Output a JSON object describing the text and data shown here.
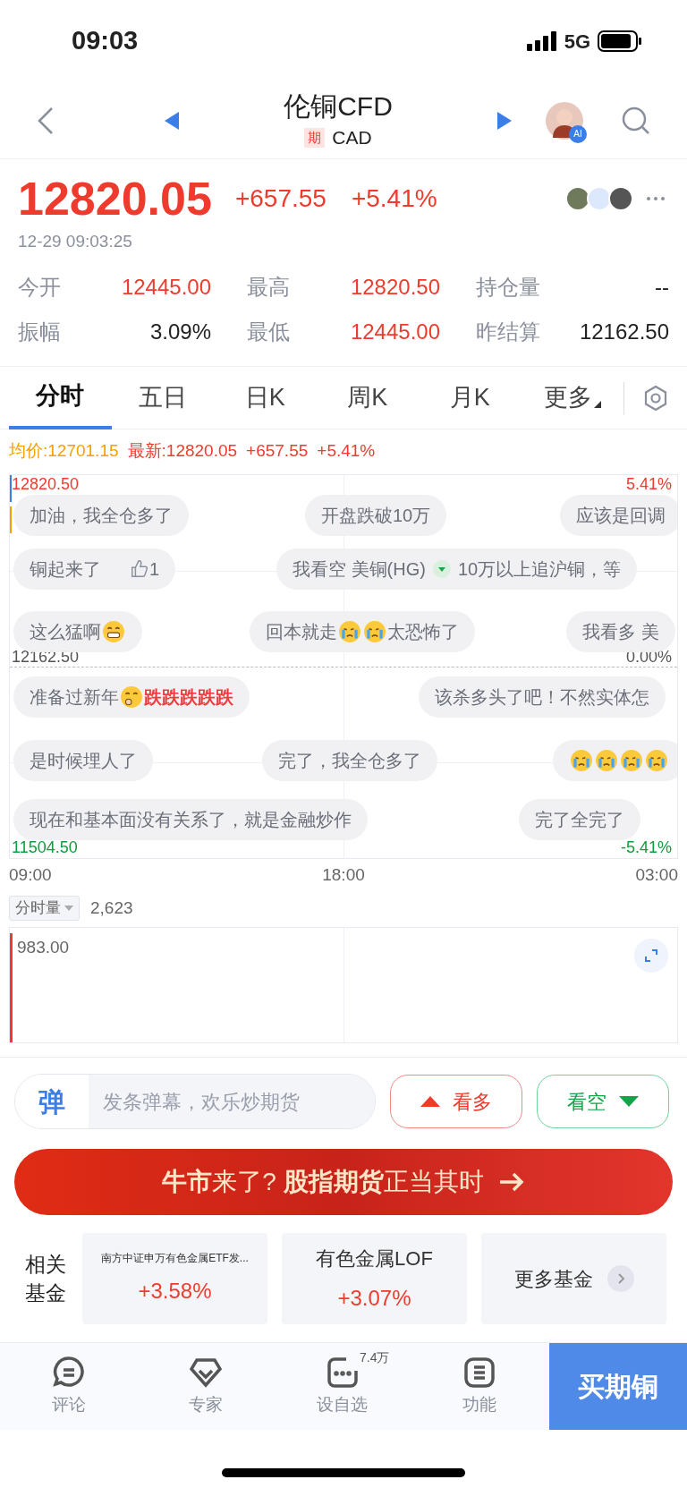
{
  "status_bar": {
    "time": "09:03",
    "network": "5G"
  },
  "header": {
    "title": "伦铜CFD",
    "badge": "期",
    "code": "CAD"
  },
  "quote": {
    "price": "12820.05",
    "change": "+657.55",
    "change_pct": "+5.41%",
    "time": "12-29 09:03:25"
  },
  "assistant_badge": "AI",
  "stats": [
    {
      "label": "今开",
      "value": "12445.00",
      "color": "#ef3b2d"
    },
    {
      "label": "最高",
      "value": "12820.50",
      "color": "#ef3b2d"
    },
    {
      "label": "持仓量",
      "value": "--",
      "color": "#222222"
    },
    {
      "label": "振幅",
      "value": "3.09%",
      "color": "#222222"
    },
    {
      "label": "最低",
      "value": "12445.00",
      "color": "#ef3b2d"
    },
    {
      "label": "昨结算",
      "value": "12162.50",
      "color": "#222222"
    }
  ],
  "tabs": [
    {
      "label": "分时",
      "selected": true
    },
    {
      "label": "五日",
      "selected": false
    },
    {
      "label": "日K",
      "selected": false
    },
    {
      "label": "周K",
      "selected": false
    },
    {
      "label": "月K",
      "selected": false
    },
    {
      "label": "更多",
      "selected": false,
      "kind": "menu"
    }
  ],
  "chart_info": {
    "avg": "均价:12701.15",
    "latest": "最新:12820.05",
    "change": "+657.55",
    "change_pct": "+5.41%"
  },
  "chart": {
    "high": "12820.50",
    "high_pct": "5.41%",
    "mid": "12162.50",
    "mid_pct": "0.00%",
    "low": "11504.50",
    "low_pct": "-5.41%",
    "times": [
      "09:00",
      "18:00",
      "03:00"
    ]
  },
  "danmaku_rows": [
    [
      [
        {
          "kind": "text",
          "text": "加油，我全仓多了"
        }
      ],
      [
        {
          "kind": "text",
          "text": "开盘跌破10万"
        }
      ],
      [
        {
          "kind": "text",
          "text": "应该是回调"
        }
      ]
    ],
    [
      [
        {
          "kind": "text",
          "text": "铜起来了"
        },
        {
          "kind": "like",
          "text": "1"
        }
      ],
      [
        {
          "kind": "text",
          "text": "我看空 美铜(HG)"
        },
        {
          "kind": "short"
        },
        {
          "kind": "text",
          "text": "10万以上追沪铜，等"
        }
      ]
    ],
    [
      [
        {
          "kind": "text",
          "text": "这么猛啊"
        },
        {
          "kind": "grin"
        }
      ],
      [
        {
          "kind": "text",
          "text": "回本就走"
        },
        {
          "kind": "cry"
        },
        {
          "kind": "cry"
        },
        {
          "kind": "text",
          "text": "太恐怖了"
        }
      ],
      [
        {
          "kind": "text",
          "text": "我看多 美"
        }
      ]
    ],
    [
      [
        {
          "kind": "text",
          "text": "准备过新年"
        },
        {
          "kind": "sneeze"
        },
        {
          "kind": "highlight",
          "text": "跌跌跌跌跌"
        }
      ],
      [
        {
          "kind": "text",
          "text": "该杀多头了吧！不然实体怎"
        }
      ]
    ],
    [
      [
        {
          "kind": "text",
          "text": "是时候埋人了"
        }
      ],
      [
        {
          "kind": "text",
          "text": "完了，我全仓多了"
        }
      ],
      [
        {
          "kind": "cry"
        },
        {
          "kind": "cry"
        },
        {
          "kind": "cry"
        },
        {
          "kind": "cry"
        }
      ]
    ],
    [
      [
        {
          "kind": "text",
          "text": "现在和基本面没有关系了，就是金融炒作"
        }
      ],
      [
        {
          "kind": "text",
          "text": "完了全完了"
        }
      ]
    ]
  ],
  "volume": {
    "selector": "分时量",
    "value": "2,623",
    "max": "983.00"
  },
  "comment_bar": {
    "logo": "弹",
    "placeholder": "发条弹幕，欢乐炒期货",
    "bull": "看多",
    "bear": "看空"
  },
  "banner": "**牛市**来了? **股指期货**正当其时",
  "funds": {
    "label": "相关基金",
    "items": [
      {
        "name": "南方中证申万有色金属ETF发...",
        "change": "+3.58%"
      },
      {
        "name": "有色金属LOF",
        "change": "+3.07%"
      }
    ],
    "more": "更多基金"
  },
  "nav": [
    {
      "label": "评论",
      "kind": "comment"
    },
    {
      "label": "专家",
      "kind": "expert"
    },
    {
      "label": "设自选",
      "kind": "watch",
      "badge": "7.4万"
    },
    {
      "label": "功能",
      "kind": "menu"
    }
  ],
  "buy": "买期铜"
}
